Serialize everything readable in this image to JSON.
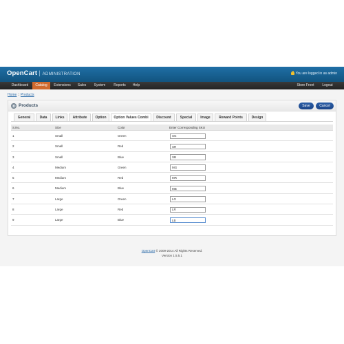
{
  "header": {
    "brand": "OpenCart",
    "separator": "|",
    "section": "ADMINISTRATION",
    "logged_in": "You are logged in as admin"
  },
  "menu": {
    "left": [
      "Dashboard",
      "Catalog",
      "Extensions",
      "Sales",
      "System",
      "Reports",
      "Help"
    ],
    "active": "Catalog",
    "right": [
      "Store Front",
      "Logout"
    ]
  },
  "breadcrumb": {
    "home": "Home",
    "sep": " :: ",
    "current": "Products"
  },
  "panel": {
    "title": "Products",
    "save": "Save",
    "cancel": "Cancel"
  },
  "tabs": [
    "General",
    "Data",
    "Links",
    "Attribute",
    "Option",
    "Option Values Combi",
    "Discount",
    "Special",
    "Image",
    "Reward Points",
    "Design"
  ],
  "active_tab": "Option Values Combi",
  "table": {
    "headers": [
      "S.No.",
      "Size",
      "Color",
      "Enter Corresponding SKU"
    ],
    "rows": [
      [
        "1",
        "Small",
        "Green",
        "SG"
      ],
      [
        "2",
        "Small",
        "Red",
        "SR"
      ],
      [
        "3",
        "Small",
        "Blue",
        "SB"
      ],
      [
        "4",
        "Medium",
        "Green",
        "MG"
      ],
      [
        "5",
        "Medium",
        "Red",
        "MR"
      ],
      [
        "6",
        "Medium",
        "Blue",
        "MB"
      ],
      [
        "7",
        "Large",
        "Green",
        "LG"
      ],
      [
        "8",
        "Large",
        "Red",
        "LR"
      ],
      [
        "9",
        "Large",
        "Blue",
        "LB"
      ]
    ]
  },
  "footer": {
    "link": "OpenCart",
    "copyright": " © 2009-2014 All Rights Reserved.",
    "version": "Version 1.5.5.1"
  },
  "colors": {
    "header": "#1a6296",
    "menu": "#2e2e2e",
    "active_menu": "#cf6a2e",
    "button": "#234f98",
    "link": "#2a6aa8"
  }
}
